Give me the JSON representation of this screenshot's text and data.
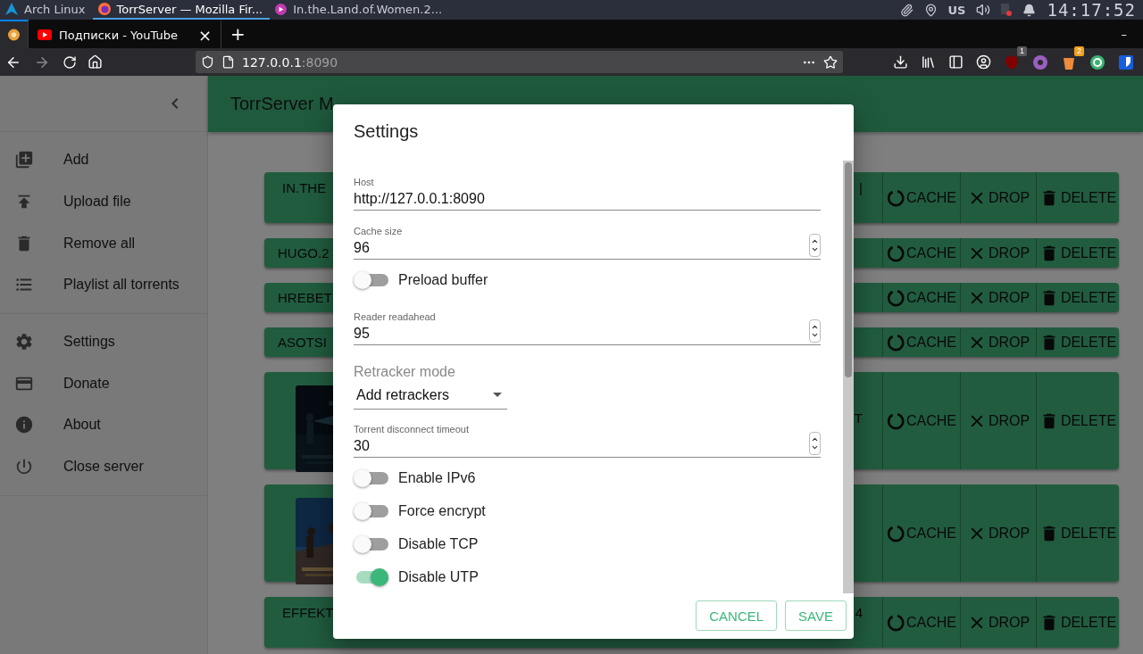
{
  "system_bar": {
    "windows": [
      {
        "kind": "arch",
        "title": "Arch Linux",
        "selected": false
      },
      {
        "kind": "firefox",
        "title": "TorrServer — Mozilla Fir...",
        "selected": true
      },
      {
        "kind": "player",
        "title": "In.the.Land.of.Women.2...",
        "selected": false
      }
    ],
    "keyboard_layout": "US",
    "clock": "14:17:52"
  },
  "browser": {
    "tabs": [
      {
        "kind": "pinned",
        "selected": true
      },
      {
        "kind": "page",
        "title": "Подписки - YouTube",
        "close": "×",
        "selected": false
      }
    ],
    "new_tab": "+",
    "minimize": "–",
    "address": {
      "host": "127.0.0.1",
      "port": ":8090"
    },
    "extensions": [
      {
        "kind": "ublock",
        "badge": "1"
      },
      {
        "kind": "disc"
      },
      {
        "kind": "bucket",
        "badge": "2"
      },
      {
        "kind": "sync"
      },
      {
        "kind": "shield"
      }
    ]
  },
  "sidebar": {
    "groups": [
      [
        {
          "kind": "add",
          "label": "Add"
        },
        {
          "kind": "upload",
          "label": "Upload file"
        },
        {
          "kind": "remove",
          "label": "Remove all"
        },
        {
          "kind": "playlist",
          "label": "Playlist all torrents"
        }
      ],
      [
        {
          "kind": "settings",
          "label": "Settings"
        },
        {
          "kind": "donate",
          "label": "Donate"
        },
        {
          "kind": "about",
          "label": "About"
        },
        {
          "kind": "close",
          "label": "Close server"
        }
      ]
    ]
  },
  "header": {
    "title": "TorrServer M"
  },
  "torrents": [
    {
      "kind": "tall",
      "name": "IN.THE",
      "tail": "|",
      "actions": [
        "CACHE",
        "DROP",
        "DELETE"
      ]
    },
    {
      "kind": "plain",
      "name": "HUGO.2",
      "actions": [
        "CACHE",
        "DROP",
        "DELETE"
      ]
    },
    {
      "kind": "plain",
      "name": "HREBET",
      "actions": [
        "CACHE",
        "DROP",
        "DELETE"
      ]
    },
    {
      "kind": "plain",
      "name": "ASOTSI",
      "actions": [
        "CACHE",
        "DROP",
        "DELETE"
      ]
    },
    {
      "kind": "poster",
      "tail": "T",
      "actions": [
        "CACHE",
        "DROP",
        "DELETE"
      ]
    },
    {
      "kind": "poster",
      "actions": [
        "CACHE",
        "DROP",
        "DELETE"
      ]
    },
    {
      "kind": "tall",
      "name": "EFFEKT",
      "tail": "4",
      "actions": [
        "CACHE",
        "DROP",
        "DELETE"
      ]
    }
  ],
  "dialog": {
    "title": "Settings",
    "fields": [
      {
        "kind": "text",
        "label": "Host",
        "value": "http://127.0.0.1:8090"
      },
      {
        "kind": "number",
        "label": "Cache size",
        "value": "96"
      },
      {
        "kind": "switch",
        "label": "Preload buffer",
        "on": false
      },
      {
        "kind": "number",
        "label": "Reader readahead",
        "value": "95"
      },
      {
        "kind": "select",
        "label": "Retracker mode",
        "value": "Add retrackers"
      },
      {
        "kind": "number",
        "label": "Torrent disconnect timeout",
        "value": "30"
      },
      {
        "kind": "switch",
        "label": "Enable IPv6",
        "on": false
      },
      {
        "kind": "switch",
        "label": "Force encrypt",
        "on": false
      },
      {
        "kind": "switch",
        "label": "Disable TCP",
        "on": false
      },
      {
        "kind": "switch",
        "label": "Disable UTP",
        "on": true
      }
    ],
    "buttons": [
      "CANCEL",
      "SAVE"
    ]
  }
}
